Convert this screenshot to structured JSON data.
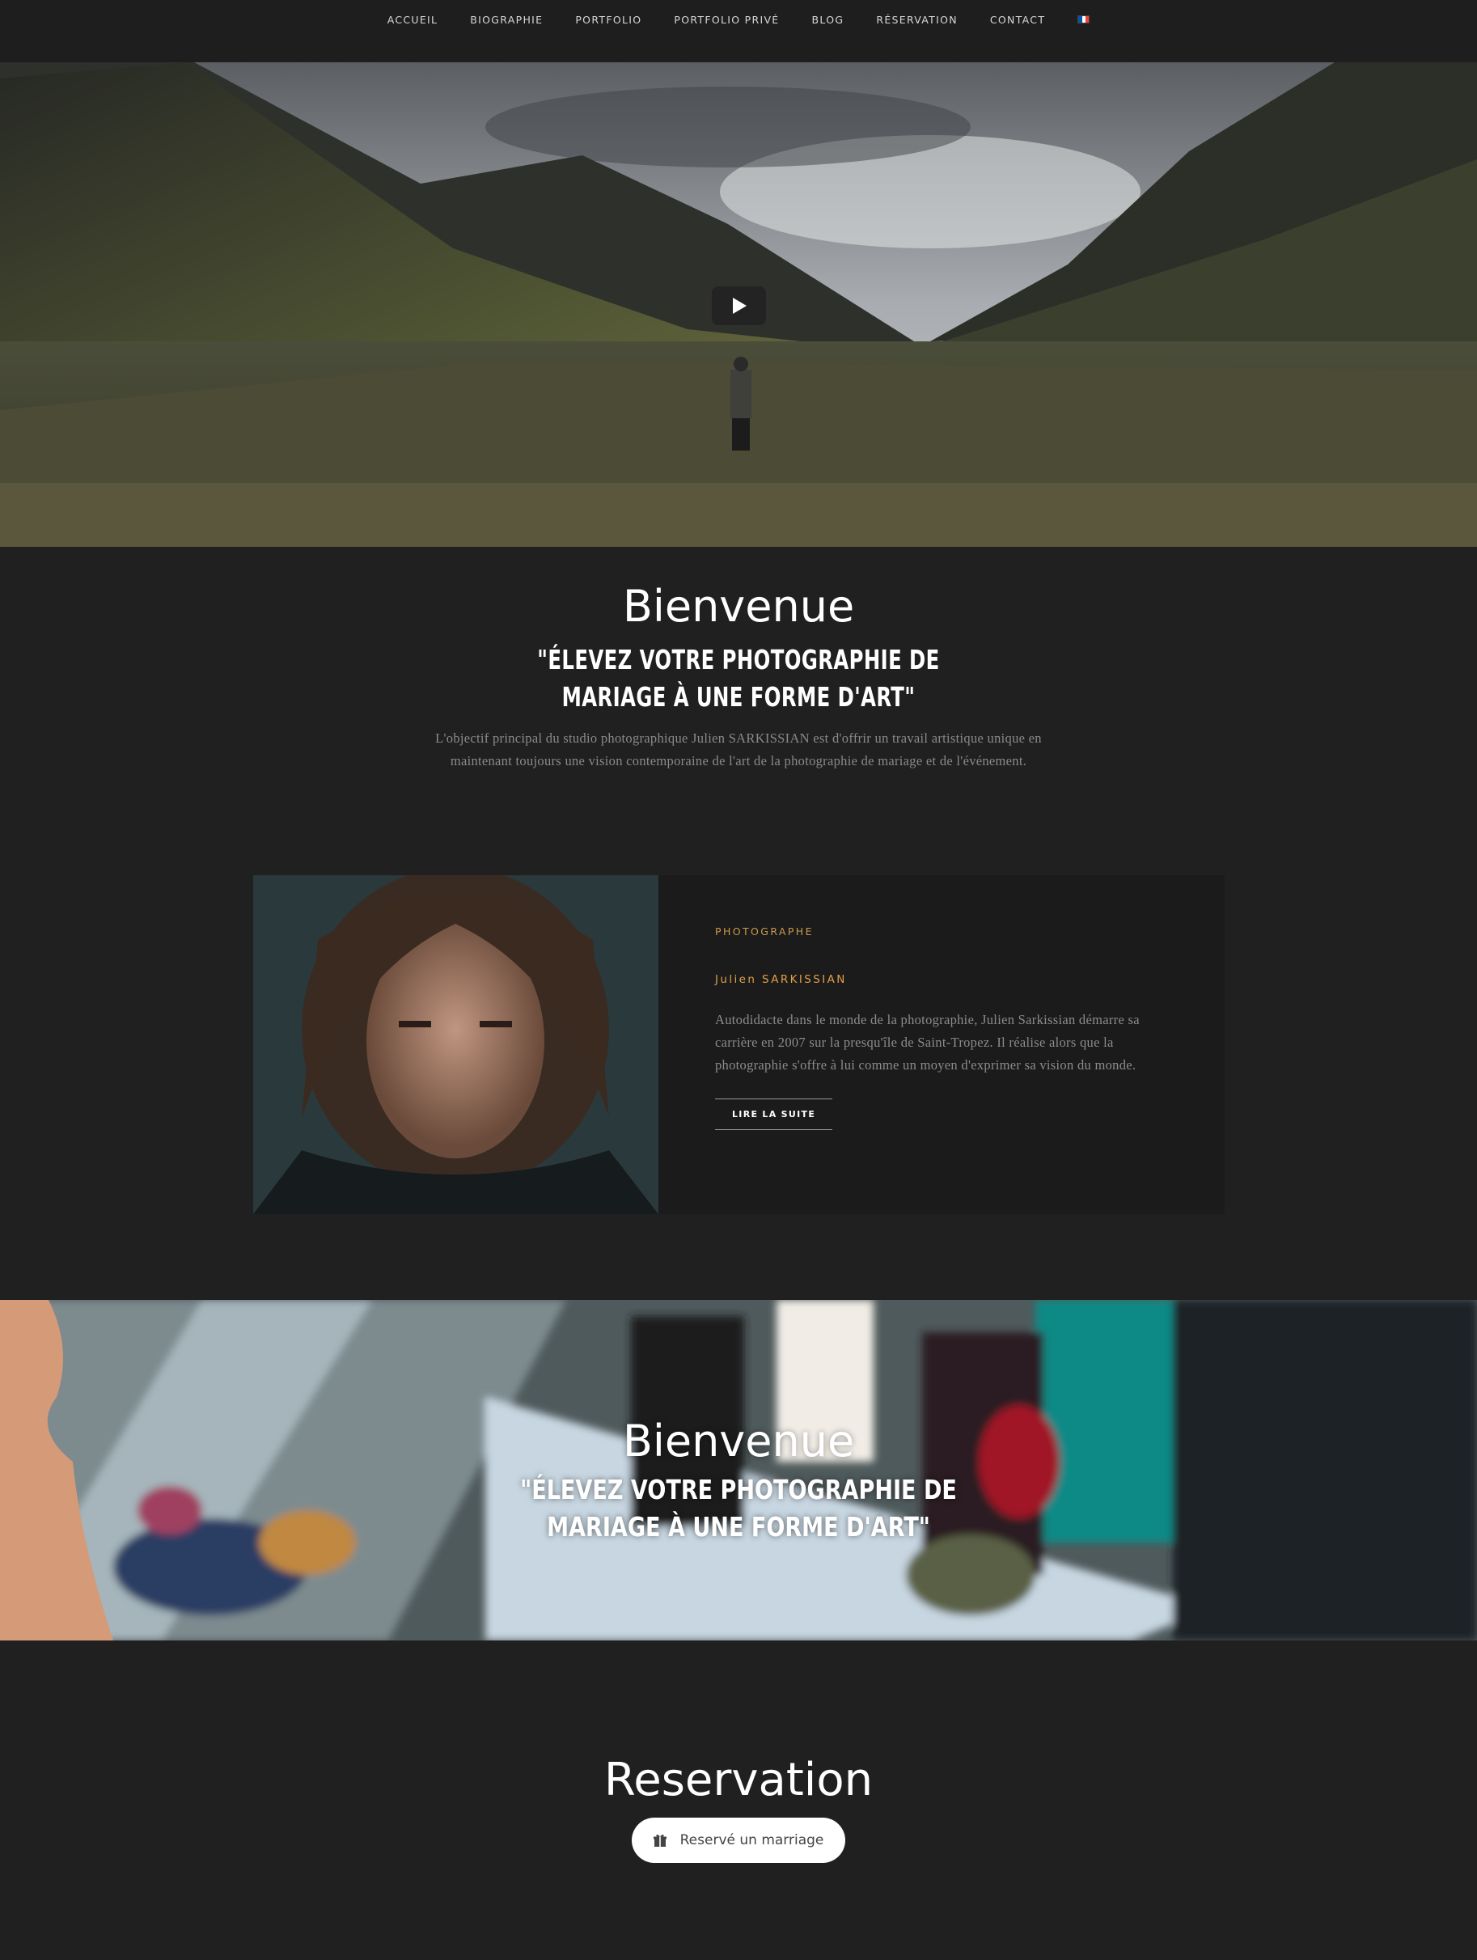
{
  "nav": {
    "items": [
      {
        "label": "ACCUEIL"
      },
      {
        "label": "BIOGRAPHIE"
      },
      {
        "label": "PORTFOLIO"
      },
      {
        "label": "PORTFOLIO PRIVÉ"
      },
      {
        "label": "BLOG"
      },
      {
        "label": "RÉSERVATION"
      },
      {
        "label": "CONTACT"
      }
    ],
    "language_icon": "french-flag-icon",
    "flag_colors": [
      "#0055a4",
      "#ffffff",
      "#ef4135"
    ]
  },
  "hero": {
    "play_icon": "play-icon"
  },
  "welcome": {
    "title": "Bienvenue",
    "subtitle": "\"ÉLEVEZ VOTRE PHOTOGRAPHIE DE MARIAGE À UNE FORME D'ART\"",
    "text": "L'objectif principal du studio photographique Julien SARKISSIAN est d'offrir un travail artistique unique en maintenant toujours une vision contemporaine de l'art de la photographie de mariage et de l'événement."
  },
  "bio": {
    "role": "PHOTOGRAPHE",
    "name": "Julien SARKISSIAN",
    "text": "Autodidacte dans le monde de la photographie, Julien Sarkissian démarre sa carrière en 2007 sur la presqu'île de Saint-Tropez. Il réalise alors que la photographie s'offre à lui comme un moyen d'exprimer sa vision du monde.",
    "button_label": "LIRE LA SUITE",
    "accent_color": "#e0a04a"
  },
  "parallax": {
    "title": "Bienvenue",
    "subtitle": "\"ÉLEVEZ VOTRE PHOTOGRAPHIE DE MARIAGE À UNE FORME D'ART\""
  },
  "reservation": {
    "title": "Reservation",
    "button_label": "Reservé un marriage",
    "button_icon": "gift-icon"
  }
}
